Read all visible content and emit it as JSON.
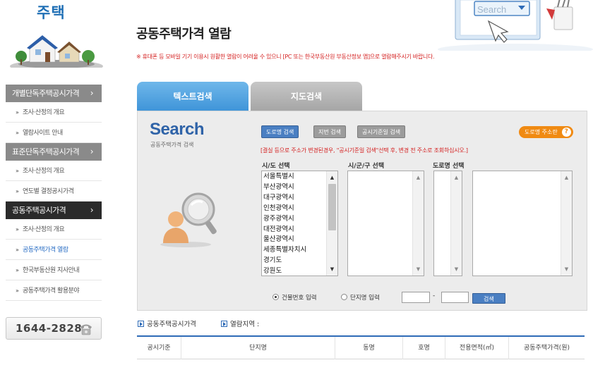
{
  "sidebar": {
    "title": "주택",
    "menu": [
      {
        "label": "개별단독주택공시가격",
        "arrow": "›",
        "active": false,
        "subs": [
          {
            "label": "조사·산정의 개요"
          },
          {
            "label": "열람사이트 안내"
          }
        ]
      },
      {
        "label": "표준단독주택공시가격",
        "arrow": "›",
        "active": false,
        "subs": [
          {
            "label": "조사·산정의 개요"
          },
          {
            "label": "연도별 결정공시가격"
          }
        ]
      },
      {
        "label": "공동주택공시가격",
        "arrow": "›",
        "active": true,
        "subs": [
          {
            "label": "조사·산정의 개요"
          },
          {
            "label": "공동주택가격 열람",
            "current": true
          },
          {
            "label": "한국부동산원 지사안내"
          },
          {
            "label": "공동주택가격 활용분야"
          }
        ]
      }
    ],
    "phone": "1644-2828"
  },
  "header": {
    "page_title": "공동주택가격 열람",
    "notice": "※ 휴대폰 등 모바일 기기 이용시 원활한 열람이 어려울 수 있으니 [PC 또는 한국부동산원 부동산정보 앱]으로 열람해주시기 바랍니다.",
    "illu_search_text": "Search"
  },
  "tabs": [
    {
      "label": "텍스트검색",
      "active": true
    },
    {
      "label": "지도검색",
      "active": false
    }
  ],
  "panel": {
    "search_word": "Search",
    "search_sub": "공동주택가격 검색",
    "btn_road": "도로명 검색",
    "btn_lot": "지번 검색",
    "btn_date": "공시기준일 검색",
    "btn_help": "도로명 주소란",
    "btn_help_icon": "?",
    "warning": "[결실 등으로 주소가 변경된경우, \"공시기준일 검색\"선택 후, 변경 전 주소로 조회하십시오.]",
    "label_sido": "시/도 선택",
    "label_sgg": "시/군/구 선택",
    "label_road": "도로명 선택",
    "sido_list": [
      "서울특별시",
      "부산광역시",
      "대구광역시",
      "인천광역시",
      "광주광역시",
      "대전광역시",
      "울산광역시",
      "세종특별자치시",
      "경기도",
      "강원도"
    ],
    "radio_building": "건물번호 입력",
    "radio_complex": "단지명 입력",
    "building_no_main": "",
    "building_no_sub": "",
    "dash": "-",
    "btn_search": "검색"
  },
  "info": {
    "price_label": "공동주택공시가격",
    "region_label": "열람지역 :"
  },
  "table": {
    "columns": [
      "공시기준",
      "단지명",
      "동명",
      "호명",
      "전용면적(㎡)",
      "공동주택가격(원)"
    ]
  }
}
